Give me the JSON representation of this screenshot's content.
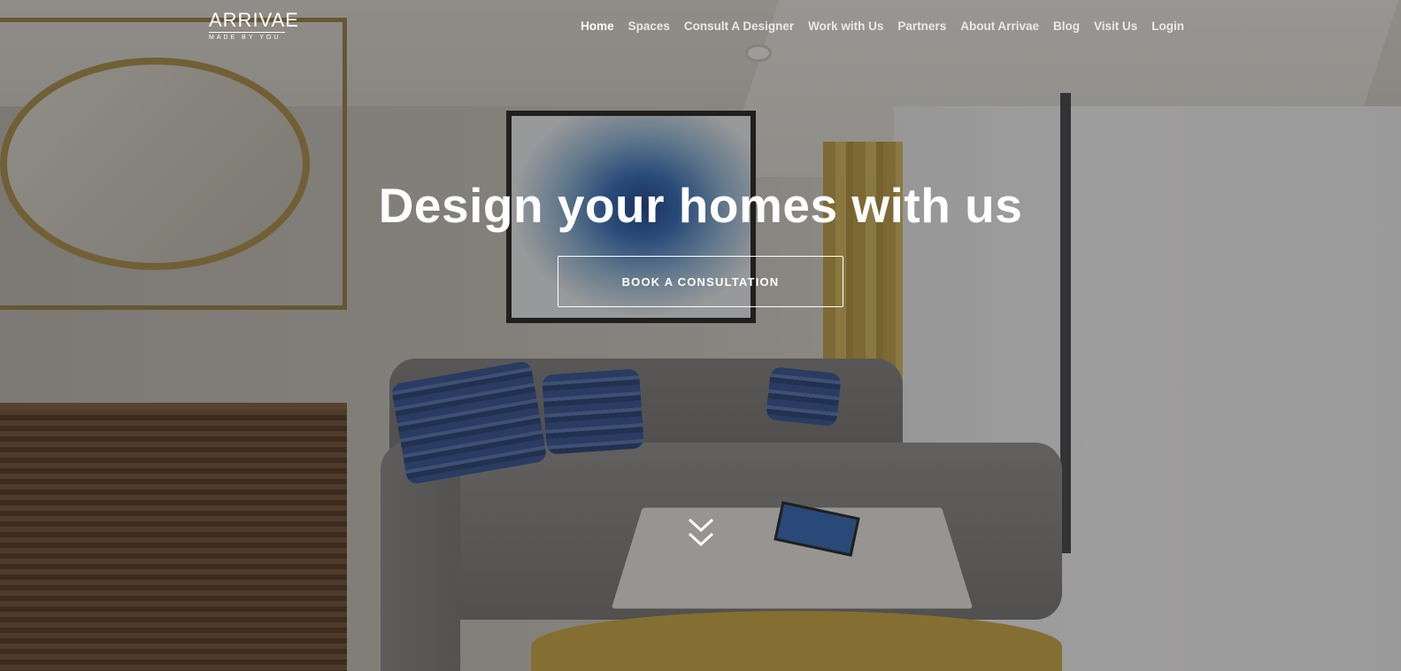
{
  "brand": {
    "name": "ARRIVAE",
    "tagline": "MADE BY YOU"
  },
  "nav": {
    "items": [
      {
        "label": "Home",
        "active": true
      },
      {
        "label": "Spaces"
      },
      {
        "label": "Consult A Designer"
      },
      {
        "label": "Work with Us"
      },
      {
        "label": "Partners"
      },
      {
        "label": "About Arrivae"
      },
      {
        "label": "Blog"
      },
      {
        "label": "Visit Us"
      },
      {
        "label": "Login"
      }
    ]
  },
  "hero": {
    "title": "Design your homes with us",
    "cta_label": "BOOK A CONSULTATION",
    "scroll_icon": "chevron-double-down-icon"
  },
  "colors": {
    "text": "#ffffff",
    "overlay": "rgba(40,38,36,0.42)"
  }
}
